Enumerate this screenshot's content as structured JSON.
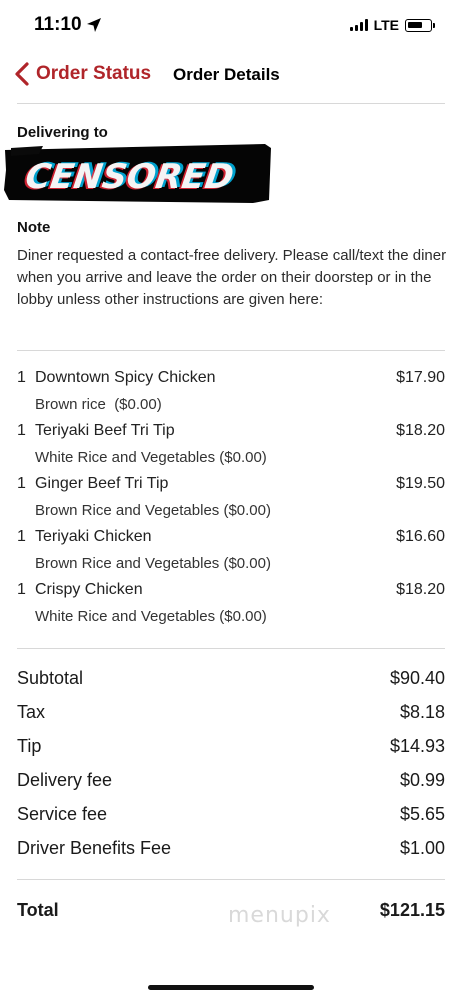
{
  "status_bar": {
    "time": "11:10",
    "network": "LTE"
  },
  "nav": {
    "back_label": "Order Status",
    "title": "Order Details",
    "accent_color": "#b0252a"
  },
  "delivery": {
    "label": "Delivering to",
    "recipient_redacted": "CENSORED"
  },
  "note": {
    "label": "Note",
    "text": "Diner requested a contact-free delivery. Please call/text the diner when you arrive and leave the order on their doorstep or in the lobby unless other instructions are given here:"
  },
  "items": [
    {
      "qty": "1",
      "name": "Downtown Spicy Chicken",
      "price": "$17.90",
      "modifier": "Brown rice  ($0.00)"
    },
    {
      "qty": "1",
      "name": "Teriyaki Beef Tri Tip",
      "price": "$18.20",
      "modifier": "White Rice and Vegetables ($0.00)"
    },
    {
      "qty": "1",
      "name": "Ginger Beef Tri Tip",
      "price": "$19.50",
      "modifier": "Brown Rice and Vegetables ($0.00)"
    },
    {
      "qty": "1",
      "name": "Teriyaki Chicken",
      "price": "$16.60",
      "modifier": "Brown Rice and Vegetables ($0.00)"
    },
    {
      "qty": "1",
      "name": "Crispy Chicken",
      "price": "$18.20",
      "modifier": "White Rice and Vegetables ($0.00)"
    }
  ],
  "totals": [
    {
      "label": "Subtotal",
      "value": "$90.40"
    },
    {
      "label": "Tax",
      "value": "$8.18"
    },
    {
      "label": "Tip",
      "value": "$14.93"
    },
    {
      "label": "Delivery fee",
      "value": "$0.99"
    },
    {
      "label": "Service fee",
      "value": "$5.65"
    },
    {
      "label": "Driver Benefits Fee",
      "value": "$1.00"
    }
  ],
  "grand_total": {
    "label": "Total",
    "value": "$121.15"
  },
  "watermark": "menupix"
}
